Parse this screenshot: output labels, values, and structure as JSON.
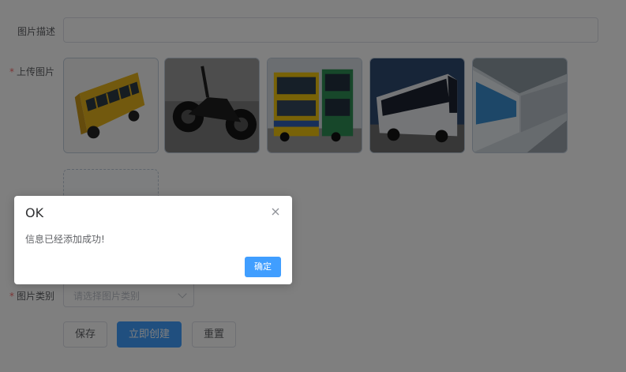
{
  "form": {
    "description_label": "图片描述",
    "upload_label": "上传图片",
    "category_label": "图片类别",
    "category_placeholder": "请选择图片类别",
    "required_mark": "*"
  },
  "thumbnails": [
    {
      "name": "school-bus-image"
    },
    {
      "name": "motorcycle-image"
    },
    {
      "name": "double-decker-bus-image"
    },
    {
      "name": "coach-bus-image"
    },
    {
      "name": "subway-train-image"
    }
  ],
  "buttons": {
    "save": "保存",
    "create": "立即创建",
    "reset": "重置"
  },
  "dialog": {
    "title": "OK",
    "message": "信息已经添加成功!",
    "confirm": "确定"
  },
  "colors": {
    "primary": "#409eff",
    "required": "#f56c6c",
    "mask": "rgba(0,0,0,0.5)"
  }
}
